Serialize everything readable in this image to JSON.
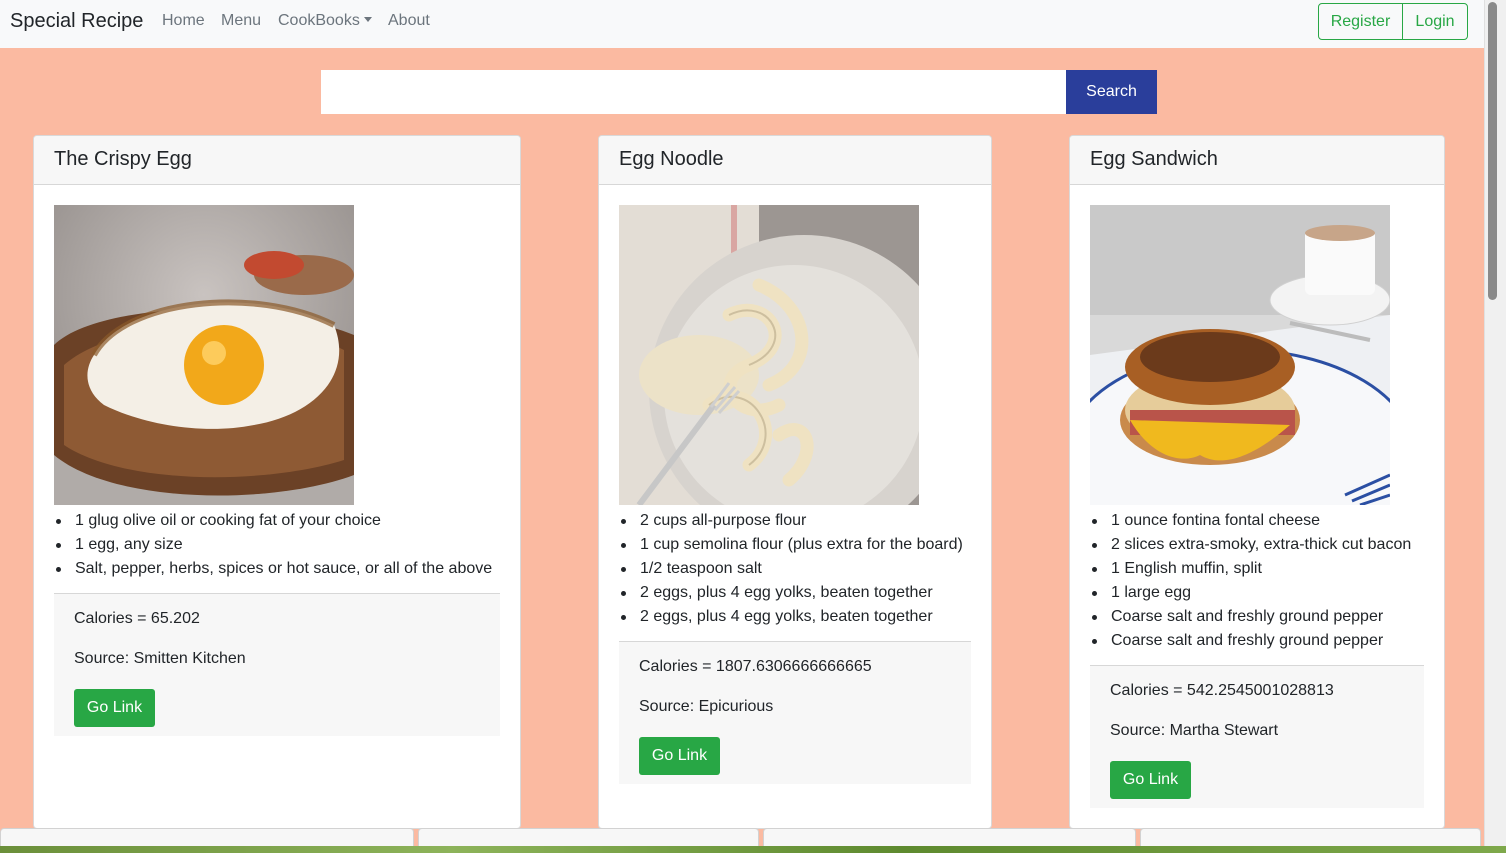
{
  "navbar": {
    "brand": "Special Recipe",
    "links": [
      "Home",
      "Menu",
      "CookBooks",
      "About"
    ],
    "register": "Register",
    "login": "Login"
  },
  "search": {
    "placeholder": "",
    "button": "Search"
  },
  "recipes": [
    {
      "title": "The Crispy Egg",
      "image": "fried-egg-on-toast",
      "ingredients": [
        "1 glug olive oil or cooking fat of your choice",
        "1 egg, any size",
        "Salt, pepper, herbs, spices or hot sauce, or all of the above"
      ],
      "calories": "Calories = 65.202",
      "source": "Source: Smitten Kitchen",
      "link": "Go Link"
    },
    {
      "title": "Egg Noodle",
      "image": "fresh-egg-noodles-plate",
      "ingredients": [
        "2 cups all-purpose flour",
        "1 cup semolina flour (plus extra for the board)",
        "1/2 teaspoon salt",
        "2 eggs, plus 4 egg yolks, beaten together",
        "2 eggs, plus 4 egg yolks, beaten together"
      ],
      "calories": "Calories = 1807.6306666666665",
      "source": "Source: Epicurious",
      "link": "Go Link"
    },
    {
      "title": "Egg Sandwich",
      "image": "english-muffin-egg-sandwich",
      "ingredients": [
        "1 ounce fontina fontal cheese",
        "2 slices extra-smoky, extra-thick cut bacon",
        "1 English muffin, split",
        "1 large egg",
        "Coarse salt and freshly ground pepper",
        "Coarse salt and freshly ground pepper"
      ],
      "calories": "Calories = 542.2545001028813",
      "source": "Source: Martha Stewart",
      "link": "Go Link"
    }
  ],
  "colors": {
    "page_background": "#fbbaa1",
    "search_button": "#2a3e9b",
    "go_button": "#28a745",
    "outline_button": "#28a745"
  }
}
